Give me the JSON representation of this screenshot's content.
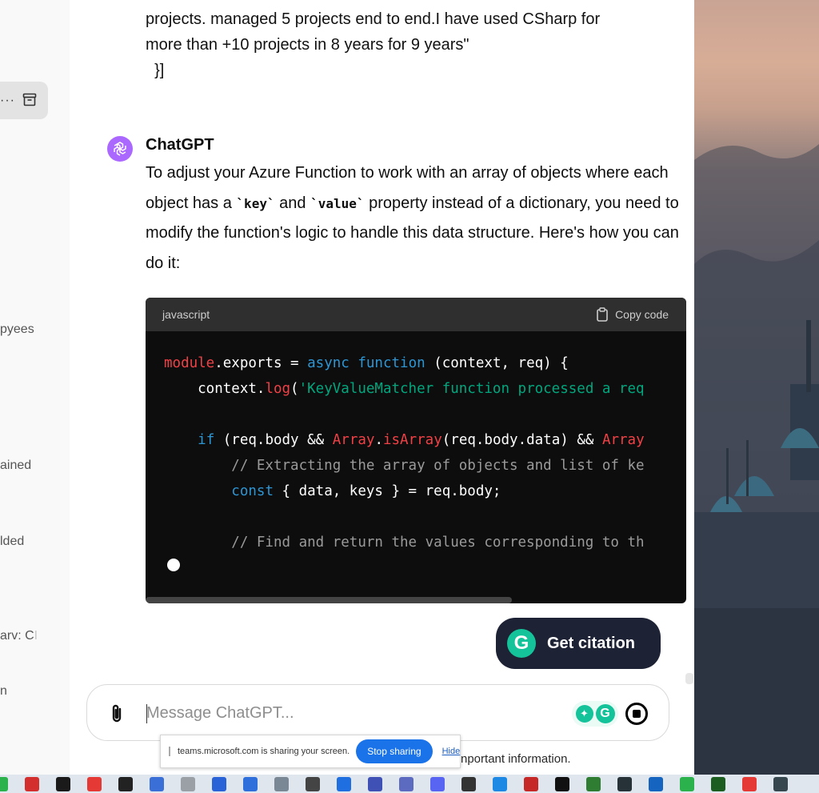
{
  "sidebar": {
    "items": [
      "pyees",
      "ained",
      "lded",
      "arv: C",
      "n"
    ],
    "item_fades": [
      "",
      "",
      "",
      "I",
      ""
    ]
  },
  "previous_message": {
    "lines": [
      "projects. managed 5 projects end to end.I have used CSharp for",
      "more than +10 projects in 8 years for 9 years\"",
      "  }]"
    ]
  },
  "response": {
    "author": "ChatGPT",
    "text_part1": "To adjust your Azure Function to work with an array of objects where each object has a ",
    "code_key": "`key`",
    "text_part2": " and ",
    "code_value": "`value`",
    "text_part3": " property instead of a dictionary, you need to modify the function's logic to handle this data structure. Here's how you can do it:"
  },
  "code_block": {
    "language": "javascript",
    "copy_label": "Copy code",
    "lines": [
      [
        {
          "t": "module",
          "c": "kw-red"
        },
        {
          "t": ".exports = ",
          "c": ""
        },
        {
          "t": "async",
          "c": "kw-blue"
        },
        {
          "t": " ",
          "c": ""
        },
        {
          "t": "function",
          "c": "kw-blue"
        },
        {
          "t": " (context, req) {",
          "c": ""
        }
      ],
      [
        {
          "t": "    context.",
          "c": ""
        },
        {
          "t": "log",
          "c": "kw-red"
        },
        {
          "t": "(",
          "c": ""
        },
        {
          "t": "'KeyValueMatcher function processed a req",
          "c": "str"
        }
      ],
      [
        {
          "t": "",
          "c": ""
        }
      ],
      [
        {
          "t": "    ",
          "c": ""
        },
        {
          "t": "if",
          "c": "kw-blue"
        },
        {
          "t": " (req.body && ",
          "c": ""
        },
        {
          "t": "Array",
          "c": "kw-red"
        },
        {
          "t": ".",
          "c": ""
        },
        {
          "t": "isArray",
          "c": "kw-red"
        },
        {
          "t": "(req.body.data) && ",
          "c": ""
        },
        {
          "t": "Array",
          "c": "kw-red"
        }
      ],
      [
        {
          "t": "        // Extracting the array of objects and list of ke",
          "c": "cmt"
        }
      ],
      [
        {
          "t": "        ",
          "c": ""
        },
        {
          "t": "const",
          "c": "kw-blue"
        },
        {
          "t": " { data, keys } = req.body;",
          "c": ""
        }
      ],
      [
        {
          "t": "",
          "c": ""
        }
      ],
      [
        {
          "t": "        // Find and return the values corresponding to th",
          "c": "cmt"
        }
      ]
    ]
  },
  "citation": {
    "label": "Get citation",
    "logo": "G"
  },
  "composer": {
    "placeholder": "Message ChatGPT..."
  },
  "disclaimer": "nportant information.",
  "screen_share": {
    "message": "teams.microsoft.com is sharing your screen.",
    "stop_label": "Stop sharing",
    "hide_label": "Hide"
  },
  "taskbar": {
    "icon_colors": [
      "#2bb24c",
      "#d32f2f",
      "#1a1a1a",
      "#e53935",
      "#222222",
      "#3b6fd8",
      "#9aa0a6",
      "#2a62d8",
      "#2f6fdb",
      "#7a8896",
      "#444444",
      "#1f6fe0",
      "#3f51b5",
      "#5c6bc0",
      "#5865f2",
      "#333333",
      "#1e88e5",
      "#c62828",
      "#111111",
      "#2e7d32",
      "#263238",
      "#1565c0",
      "#2bb24c",
      "#1b5e20",
      "#e53935",
      "#37474f"
    ]
  }
}
